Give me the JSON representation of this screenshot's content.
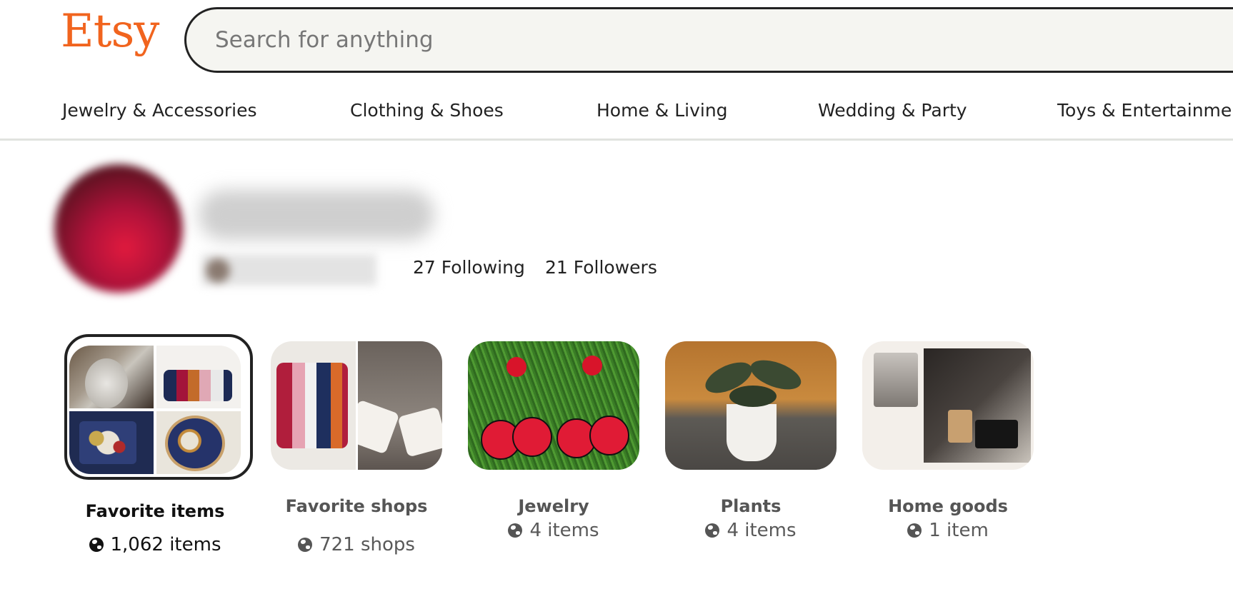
{
  "brand": {
    "logo_text": "Etsy",
    "color": "#f1641e"
  },
  "search": {
    "placeholder": "Search for anything"
  },
  "nav": {
    "items": [
      "Jewelry & Accessories",
      "Clothing & Shoes",
      "Home & Living",
      "Wedding & Party",
      "Toys & Entertainment"
    ]
  },
  "profile": {
    "following": "27 Following",
    "followers": "21 Followers"
  },
  "collections": [
    {
      "title": "Favorite items",
      "count": "1,062 items",
      "selected": true,
      "globe_icon": "globe-icon"
    },
    {
      "title": "Favorite shops",
      "count": "721 shops",
      "selected": false,
      "globe_icon": "globe-icon"
    },
    {
      "title": "Jewelry",
      "count": "4 items",
      "selected": false,
      "globe_icon": "globe-icon"
    },
    {
      "title": "Plants",
      "count": "4 items",
      "selected": false,
      "globe_icon": "globe-icon"
    },
    {
      "title": "Home goods",
      "count": "1 item",
      "selected": false,
      "globe_icon": "globe-icon"
    }
  ],
  "colors": {
    "text": "#222222",
    "muted": "#595959",
    "divider": "#e1e3df",
    "search_bg": "#f5f5f1"
  }
}
